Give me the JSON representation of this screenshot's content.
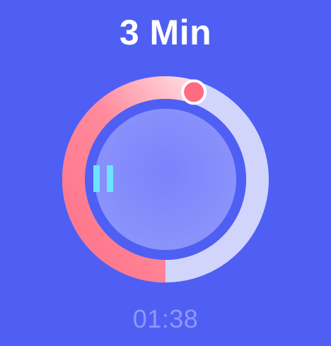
{
  "timer": {
    "title": "3 Min",
    "elapsed": "01:38",
    "progress_fraction": 0.55,
    "state": "running"
  },
  "icons": {
    "pause": "pause-icon",
    "handle": "progress-handle"
  },
  "colors": {
    "background": "#4f5ff4",
    "progress_start": "#ff7288",
    "progress_end": "#ffd3dc",
    "track": "#d2d5fb",
    "inner_circle": "#8891fb",
    "handle": "#ff6b80",
    "pause_icon": "#6fe3ff",
    "readout": "#8e97f8"
  }
}
